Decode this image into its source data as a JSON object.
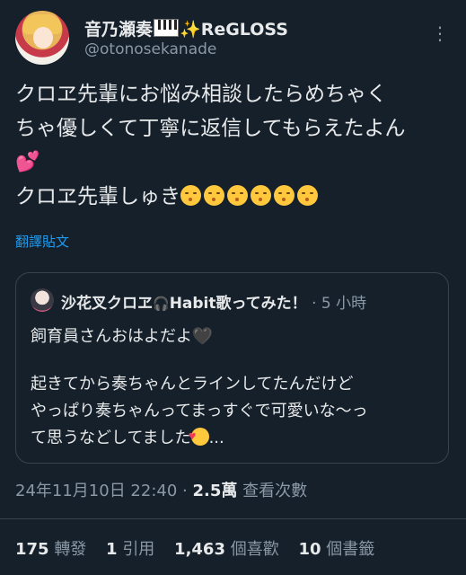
{
  "author": {
    "name_main": "音乃瀬奏",
    "name_suffix": "ReGLOSS",
    "handle": "@otonosekanade"
  },
  "tweet": {
    "line1": "クロヱ先輩にお悩み相談したらめちゃく",
    "line2": "ちゃ優しくて丁寧に返信してもらえたよん",
    "line3_emoji": "💕",
    "line4": "クロヱ先輩しゅき",
    "translate_link": "翻譯貼文"
  },
  "quote": {
    "name": "沙花叉クロヱ",
    "name_tail": "Habit歌ってみた！",
    "time": " · 5 小時",
    "line1": "飼育員さんおはよだよ",
    "line2": "起きてから奏ちゃんとラインしてたんだけど",
    "line3": "やっぱり奏ちゃんってまっすぐで可愛いな〜っ",
    "line4": "て思うなどしてました",
    "line4_tail": "..."
  },
  "meta": {
    "datetime": "24年11月10日 22:40 · ",
    "views": "2.5萬",
    "views_label": " 查看次數"
  },
  "stats": [
    {
      "num": "175",
      "label": "轉發"
    },
    {
      "num": "1",
      "label": "引用"
    },
    {
      "num": "1,463",
      "label": "個喜歡"
    },
    {
      "num": "10",
      "label": "個書籤"
    }
  ]
}
